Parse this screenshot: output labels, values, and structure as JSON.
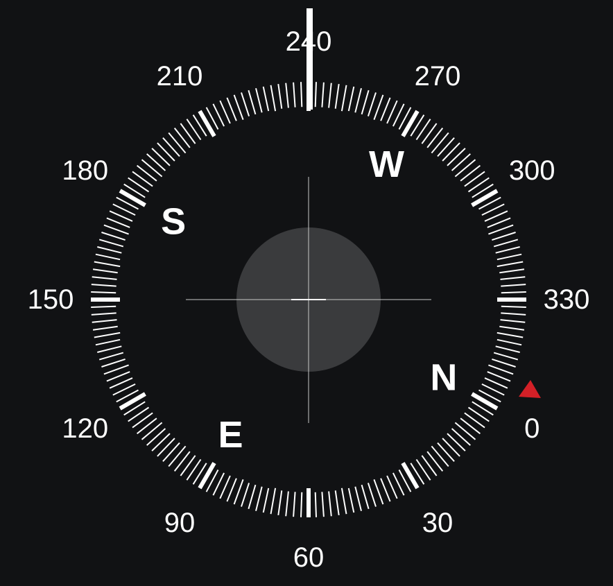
{
  "compass": {
    "heading": 240,
    "heading_indicator": "heading-line-marker",
    "north_indicator": "triangle-marker",
    "north_indicator_color": "#d32027",
    "degree_labels": [
      "0",
      "30",
      "60",
      "90",
      "120",
      "150",
      "180",
      "210",
      "240",
      "270",
      "300",
      "330"
    ],
    "cardinals": [
      "N",
      "E",
      "S",
      "W"
    ],
    "colors": {
      "background": "#111214",
      "ticks": "#ffffff",
      "level_bubble": "#3a3b3d",
      "crosshair": "#c8c8c8"
    }
  }
}
